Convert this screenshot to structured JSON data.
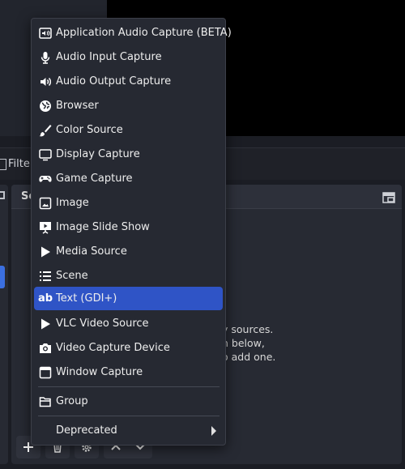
{
  "filter_bar": {
    "label": "Filter"
  },
  "sources": {
    "title": "So",
    "empty_lines": [
      "y sources.",
      "n below,",
      "o add one."
    ]
  },
  "menu": {
    "items": [
      {
        "label": "Application Audio Capture (BETA)",
        "icon": "app-audio-icon"
      },
      {
        "label": "Audio Input Capture",
        "icon": "microphone-icon"
      },
      {
        "label": "Audio Output Capture",
        "icon": "speaker-icon"
      },
      {
        "label": "Browser",
        "icon": "globe-icon"
      },
      {
        "label": "Color Source",
        "icon": "brush-icon"
      },
      {
        "label": "Display Capture",
        "icon": "monitor-icon"
      },
      {
        "label": "Game Capture",
        "icon": "gamepad-icon"
      },
      {
        "label": "Image",
        "icon": "image-icon"
      },
      {
        "label": "Image Slide Show",
        "icon": "slideshow-icon"
      },
      {
        "label": "Media Source",
        "icon": "play-icon"
      },
      {
        "label": "Scene",
        "icon": "list-icon"
      },
      {
        "label": "Text (GDI+)",
        "icon": "text-icon",
        "icon_text": "ab",
        "selected": true
      },
      {
        "label": "VLC Video Source",
        "icon": "play-icon"
      },
      {
        "label": "Video Capture Device",
        "icon": "camera-icon"
      },
      {
        "label": "Window Capture",
        "icon": "window-icon"
      }
    ],
    "group": {
      "label": "Group",
      "icon": "folder-icon"
    },
    "deprecated": {
      "label": "Deprecated"
    }
  },
  "colors": {
    "selected": "#2f54c6",
    "menu_bg": "#262932",
    "panel_bg": "#272a33"
  }
}
